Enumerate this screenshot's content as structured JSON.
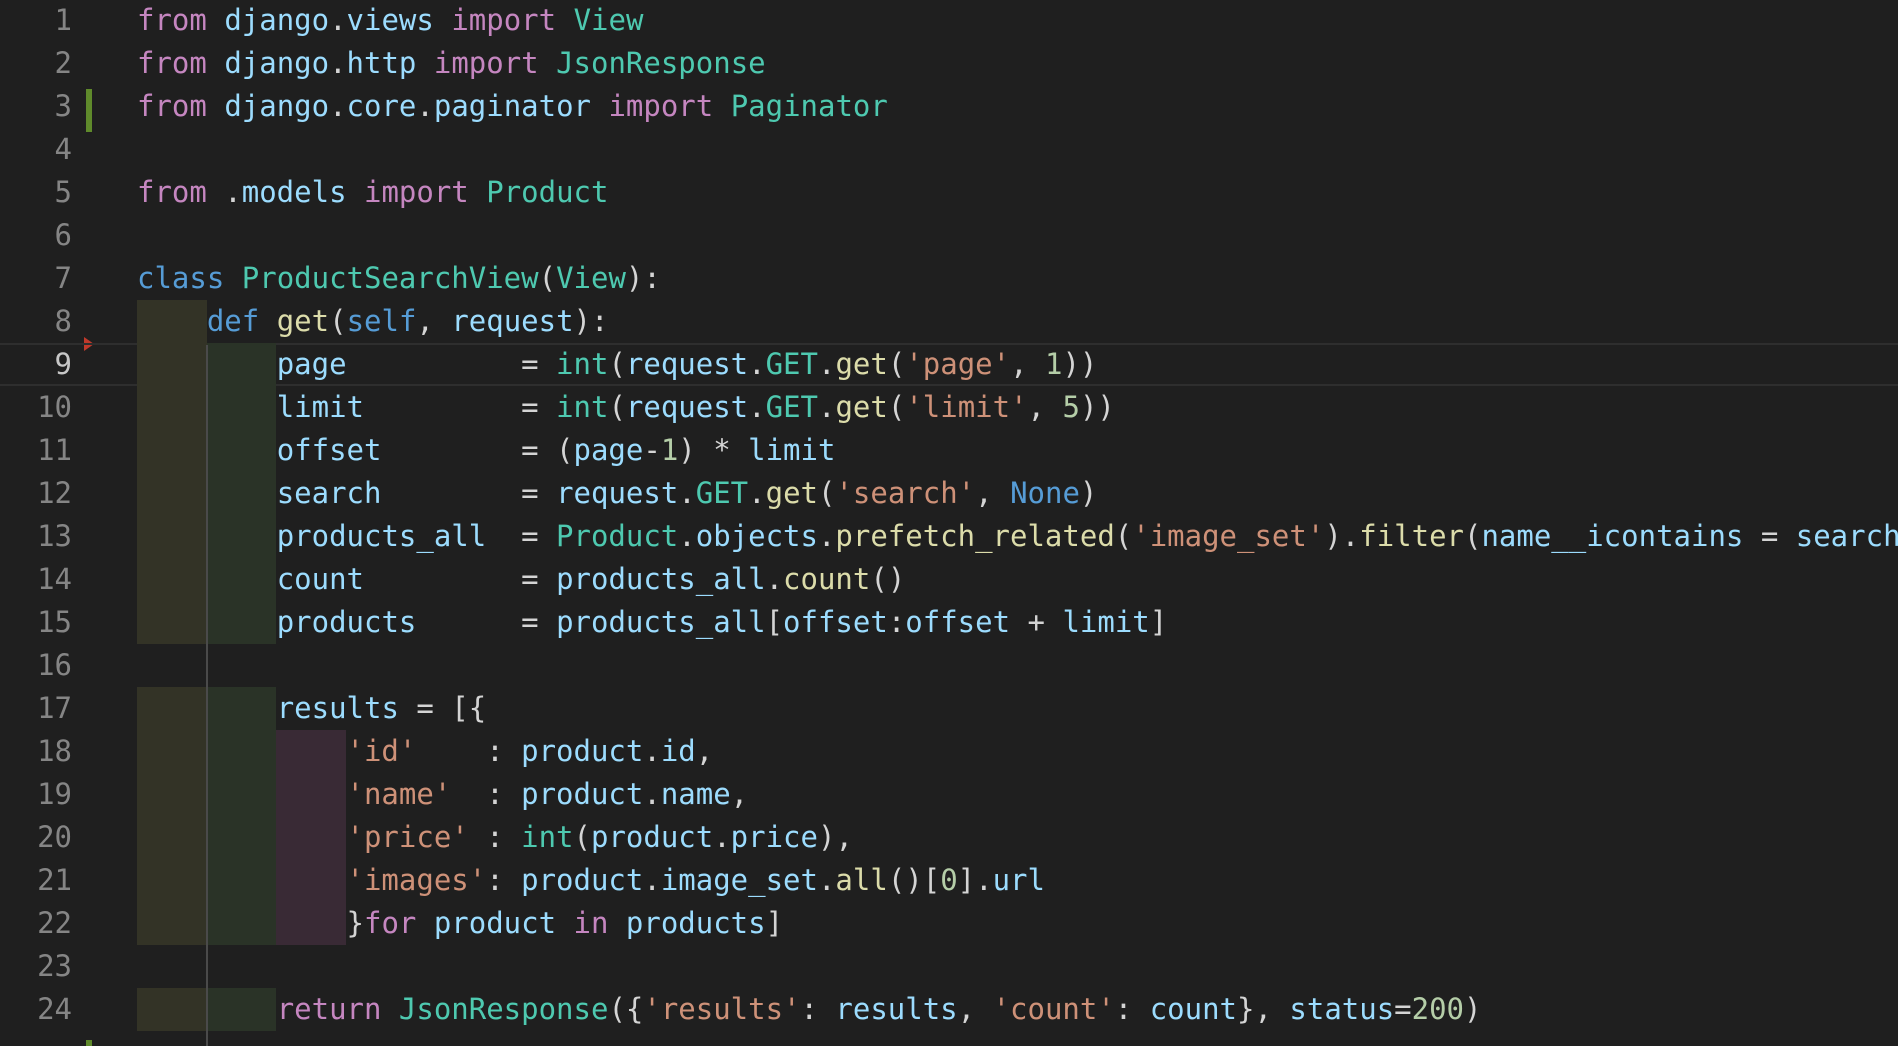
{
  "editor": {
    "language": "python",
    "current_line": 9,
    "lines": [
      {
        "n": "1",
        "text": "from django.views import View"
      },
      {
        "n": "2",
        "text": "from django.http import JsonResponse"
      },
      {
        "n": "3",
        "text": "from django.core.paginator import Paginator"
      },
      {
        "n": "4",
        "text": ""
      },
      {
        "n": "5",
        "text": "from .models import Product"
      },
      {
        "n": "6",
        "text": ""
      },
      {
        "n": "7",
        "text": "class ProductSearchView(View):"
      },
      {
        "n": "8",
        "text": "    def get(self, request):"
      },
      {
        "n": "9",
        "text": "        page          = int(request.GET.get('page', 1))"
      },
      {
        "n": "10",
        "text": "        limit         = int(request.GET.get('limit', 5))"
      },
      {
        "n": "11",
        "text": "        offset        = (page-1) * limit"
      },
      {
        "n": "12",
        "text": "        search        = request.GET.get('search', None)"
      },
      {
        "n": "13",
        "text": "        products_all  = Product.objects.prefetch_related('image_set').filter(name__icontains = search)"
      },
      {
        "n": "14",
        "text": "        count         = products_all.count()"
      },
      {
        "n": "15",
        "text": "        products      = products_all[offset:offset + limit]"
      },
      {
        "n": "16",
        "text": ""
      },
      {
        "n": "17",
        "text": "        results = [{"
      },
      {
        "n": "18",
        "text": "            'id'    : product.id,"
      },
      {
        "n": "19",
        "text": "            'name'  : product.name,"
      },
      {
        "n": "20",
        "text": "            'price' : int(product.price),"
      },
      {
        "n": "21",
        "text": "            'images': product.image_set.all()[0].url"
      },
      {
        "n": "22",
        "text": "            }for product in products]"
      },
      {
        "n": "23",
        "text": ""
      },
      {
        "n": "24",
        "text": "        return JsonResponse({'results': results, 'count': count}, status=200)"
      }
    ],
    "colors": {
      "background": "#1f1f1f",
      "keyword": "#c586c0",
      "builtin_keyword": "#569cd6",
      "class": "#4ec9b0",
      "function": "#dcdcaa",
      "variable": "#9cdcfe",
      "string": "#ce9178",
      "number": "#b5cea8",
      "gutter_modified": "#5f8a2b",
      "breakpoint": "#c0392b"
    }
  }
}
